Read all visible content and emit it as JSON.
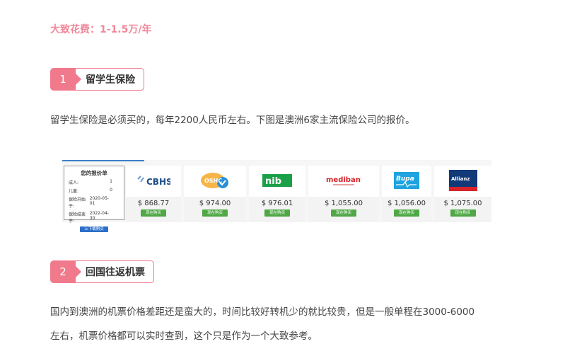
{
  "cost_line": "大致花费：1-1.5万/年",
  "section1": {
    "num": "1",
    "title": "留学生保险",
    "para": "留学生保险是必须买的，每年2200人民币左右。下图是澳洲6家主流保险公司的报价。"
  },
  "quote": {
    "title": "您的报价单",
    "rows": [
      {
        "k": "成人:",
        "v": "1"
      },
      {
        "k": "儿童:",
        "v": "0"
      },
      {
        "k": "保险开始于:",
        "v": "2020-05-01"
      },
      {
        "k": "保险结束于:",
        "v": "2022-04-30"
      }
    ],
    "button": "上下载购买"
  },
  "insurers": [
    {
      "name": "CBHS",
      "price": "$ 868.77",
      "buy": "现在购买"
    },
    {
      "name": "OSHC",
      "price": "$ 974.00",
      "buy": "现在购买"
    },
    {
      "name": "nib",
      "price": "$ 976.01",
      "buy": "现在购买"
    },
    {
      "name": "medibank",
      "price": "$ 1,055.00",
      "buy": "现在购买"
    },
    {
      "name": "Bupa",
      "price": "$ 1,056.00",
      "buy": "现在购买"
    },
    {
      "name": "Allianz",
      "price": "$ 1,075.00",
      "buy": "现在购买"
    }
  ],
  "section2": {
    "num": "2",
    "title": "回国往返机票",
    "para_line1": "国内到澳洲的机票价格差距还是蛮大的，时间比较好转机少的就比较贵，但是一般单程在3000-6000",
    "para_line2": "左右，机票价格都可以实时查到，这个只是作为一个大致参考。"
  },
  "colors": {
    "accent": "#f07a8b",
    "buy_green": "#4fa845",
    "blue": "#2a6fca"
  }
}
